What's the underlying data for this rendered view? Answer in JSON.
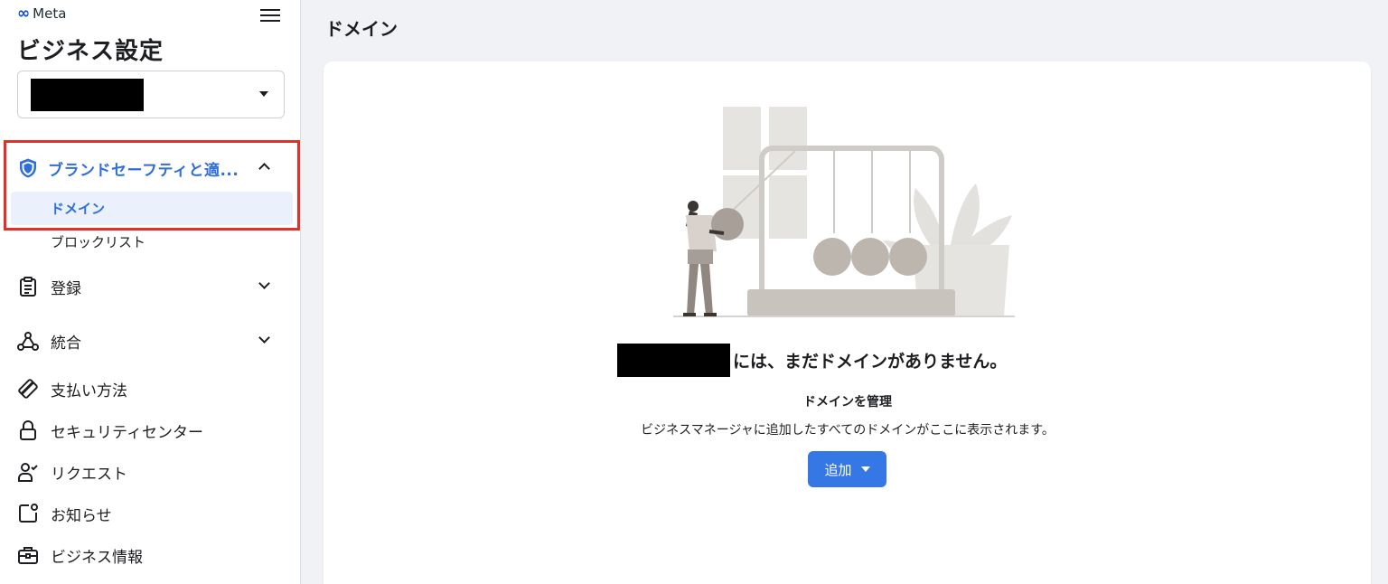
{
  "header": {
    "logo_text": "Meta",
    "app_title": "ビジネス設定"
  },
  "sidebar": {
    "group_expanded": {
      "label": "ブランドセーフティと適..."
    },
    "sub_items": [
      {
        "label": "ドメイン",
        "active": true
      },
      {
        "label": "ブロックリスト",
        "active": false
      }
    ],
    "items": [
      {
        "label": "登録",
        "icon": "clipboard-icon",
        "expandable": true
      },
      {
        "label": "統合",
        "icon": "nodes-icon",
        "expandable": true
      },
      {
        "label": "支払い方法",
        "icon": "card-icon",
        "expandable": false
      },
      {
        "label": "セキュリティセンター",
        "icon": "lock-icon",
        "expandable": false
      },
      {
        "label": "リクエスト",
        "icon": "person-check-icon",
        "expandable": false
      },
      {
        "label": "お知らせ",
        "icon": "notification-icon",
        "expandable": false
      },
      {
        "label": "ビジネス情報",
        "icon": "briefcase-icon",
        "expandable": false
      }
    ]
  },
  "main": {
    "title": "ドメイン",
    "empty_state": {
      "headline": "には、まだドメインがありません。",
      "subheading": "ドメインを管理",
      "description": "ビジネスマネージャに追加したすべてのドメインがここに表示されます。",
      "add_button_label": "追加"
    }
  },
  "colors": {
    "accent": "#3578e5",
    "active_text": "#2f6fd6",
    "highlight_border": "#e2312a"
  }
}
